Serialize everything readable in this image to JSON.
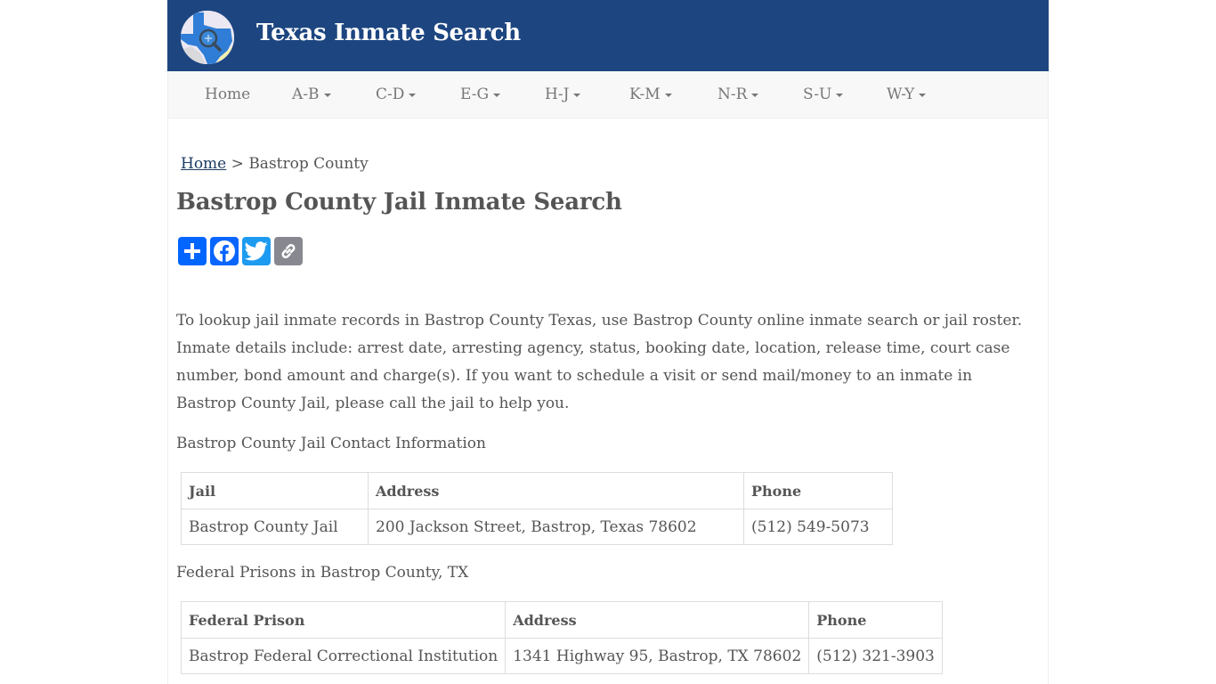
{
  "header": {
    "site_title": "Texas Inmate Search",
    "logo_icon": "texas-map-magnifier-logo",
    "brand_color": "#1d4681"
  },
  "nav": {
    "items": [
      {
        "label": "Home",
        "dropdown": false
      },
      {
        "label": "A-B",
        "dropdown": true
      },
      {
        "label": "C-D",
        "dropdown": true
      },
      {
        "label": "E-G",
        "dropdown": true
      },
      {
        "label": "H-J",
        "dropdown": true
      },
      {
        "label": "K-M",
        "dropdown": true
      },
      {
        "label": "N-R",
        "dropdown": true
      },
      {
        "label": "S-U",
        "dropdown": true
      },
      {
        "label": "W-Y",
        "dropdown": true
      }
    ]
  },
  "breadcrumb": {
    "home_label": "Home",
    "separator": ">",
    "current": "Bastrop County"
  },
  "page_title": "Bastrop County Jail Inmate Search",
  "share_buttons": [
    {
      "name": "share",
      "icon": "plus-icon",
      "color": "#0166ff"
    },
    {
      "name": "facebook",
      "icon": "facebook-icon",
      "color": "#0866ff"
    },
    {
      "name": "twitter",
      "icon": "twitter-icon",
      "color": "#1d9bf0"
    },
    {
      "name": "copy-link",
      "icon": "link-icon",
      "color": "#888990"
    }
  ],
  "intro_text": "To lookup jail inmate records in Bastrop County Texas, use Bastrop County online inmate search or jail roster. Inmate details include: arrest date, arresting agency, status, booking date, location, release time, court case number, bond amount and charge(s). If you want to schedule a visit or send mail/money to an inmate in Bastrop County Jail, please call the jail to help you.",
  "jail_section": {
    "heading": "Bastrop County Jail Contact Information",
    "columns": [
      "Jail",
      "Address",
      "Phone"
    ],
    "rows": [
      [
        "Bastrop County Jail",
        "200 Jackson Street, Bastrop, Texas 78602",
        "(512) 549-5073"
      ]
    ]
  },
  "federal_section": {
    "heading": "Federal Prisons in Bastrop County, TX",
    "columns": [
      "Federal Prison",
      "Address",
      "Phone"
    ],
    "rows": [
      [
        "Bastrop Federal Correctional Institution",
        "1341 Highway 95, Bastrop, TX 78602",
        "(512) 321-3903"
      ]
    ]
  }
}
